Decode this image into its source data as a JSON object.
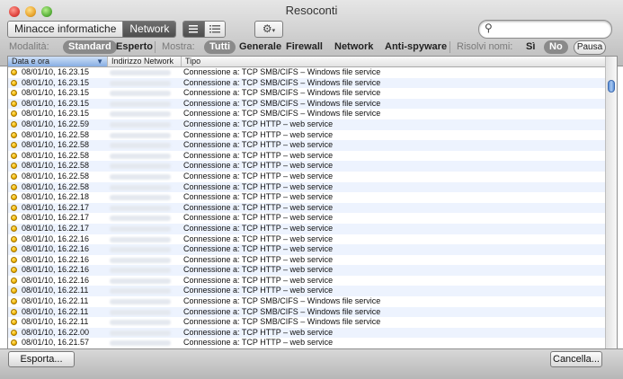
{
  "window": {
    "title": "Resoconti"
  },
  "toolbar": {
    "segments": [
      {
        "label": "Minacce informatiche",
        "selected": false
      },
      {
        "label": "Network",
        "selected": true
      }
    ],
    "search": {
      "value": "",
      "placeholder": ""
    }
  },
  "filters": {
    "modalita_label": "Modalità:",
    "modalita_options": [
      "Standard",
      "Esperto"
    ],
    "mostra_label": "Mostra:",
    "mostra_options": [
      "Tutti",
      "Generale",
      "Firewall",
      "Network",
      "Anti-spyware"
    ],
    "risolvi_label": "Risolvi nomi:",
    "risolvi_options": [
      "Sì",
      "No"
    ],
    "pausa_label": "Pausa"
  },
  "table": {
    "columns": [
      "Data e ora",
      "Indirizzo Network",
      "Tipo"
    ],
    "rows": [
      {
        "date": "08/01/10, 16.23.15",
        "type": "Connessione a: TCP SMB/CIFS – Windows file service"
      },
      {
        "date": "08/01/10, 16.23.15",
        "type": "Connessione a: TCP SMB/CIFS – Windows file service"
      },
      {
        "date": "08/01/10, 16.23.15",
        "type": "Connessione a: TCP SMB/CIFS – Windows file service"
      },
      {
        "date": "08/01/10, 16.23.15",
        "type": "Connessione a: TCP SMB/CIFS – Windows file service"
      },
      {
        "date": "08/01/10, 16.23.15",
        "type": "Connessione a: TCP SMB/CIFS – Windows file service"
      },
      {
        "date": "08/01/10, 16.22.59",
        "type": "Connessione a: TCP HTTP – web service"
      },
      {
        "date": "08/01/10, 16.22.58",
        "type": "Connessione a: TCP HTTP – web service"
      },
      {
        "date": "08/01/10, 16.22.58",
        "type": "Connessione a: TCP HTTP – web service"
      },
      {
        "date": "08/01/10, 16.22.58",
        "type": "Connessione a: TCP HTTP – web service"
      },
      {
        "date": "08/01/10, 16.22.58",
        "type": "Connessione a: TCP HTTP – web service"
      },
      {
        "date": "08/01/10, 16.22.58",
        "type": "Connessione a: TCP HTTP – web service"
      },
      {
        "date": "08/01/10, 16.22.58",
        "type": "Connessione a: TCP HTTP – web service"
      },
      {
        "date": "08/01/10, 16.22.18",
        "type": "Connessione a: TCP HTTP – web service"
      },
      {
        "date": "08/01/10, 16.22.17",
        "type": "Connessione a: TCP HTTP – web service"
      },
      {
        "date": "08/01/10, 16.22.17",
        "type": "Connessione a: TCP HTTP – web service"
      },
      {
        "date": "08/01/10, 16.22.17",
        "type": "Connessione a: TCP HTTP – web service"
      },
      {
        "date": "08/01/10, 16.22.16",
        "type": "Connessione a: TCP HTTP – web service"
      },
      {
        "date": "08/01/10, 16.22.16",
        "type": "Connessione a: TCP HTTP – web service"
      },
      {
        "date": "08/01/10, 16.22.16",
        "type": "Connessione a: TCP HTTP – web service"
      },
      {
        "date": "08/01/10, 16.22.16",
        "type": "Connessione a: TCP HTTP – web service"
      },
      {
        "date": "08/01/10, 16.22.16",
        "type": "Connessione a: TCP HTTP – web service"
      },
      {
        "date": "08/01/10, 16.22.11",
        "type": "Connessione a: TCP HTTP – web service"
      },
      {
        "date": "08/01/10, 16.22.11",
        "type": "Connessione a: TCP SMB/CIFS – Windows file service"
      },
      {
        "date": "08/01/10, 16.22.11",
        "type": "Connessione a: TCP SMB/CIFS – Windows file service"
      },
      {
        "date": "08/01/10, 16.22.11",
        "type": "Connessione a: TCP SMB/CIFS – Windows file service"
      },
      {
        "date": "08/01/10, 16.22.00",
        "type": "Connessione a: TCP HTTP – web service"
      },
      {
        "date": "08/01/10, 16.21.57",
        "type": "Connessione a: TCP HTTP – web service"
      }
    ]
  },
  "footer": {
    "export_label": "Esporta...",
    "cancel_label": "Cancella..."
  }
}
